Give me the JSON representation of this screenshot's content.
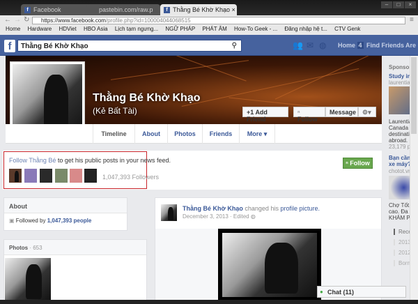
{
  "browser": {
    "tabs": [
      {
        "label": "Facebook"
      },
      {
        "label": "pastebin.com/raw.p"
      },
      {
        "label": "Thằng Bé Khờ Khạo"
      }
    ],
    "url_host": "https://www.facebook.com",
    "url_path": "/profile.php?id=100004044068515",
    "bookmarks": [
      "Home",
      "Hardware",
      "HDViet",
      "HBO Asia",
      "Lịch tạm ngưng...",
      "NGỮ PHÁP",
      "PHÁT ÂM",
      "How-To Geek - ...",
      "Đăng nhập hệ t...",
      "CTV Genk"
    ]
  },
  "fb": {
    "search_value": "Thằng Bé Khờ Khạo",
    "nav": {
      "home": "Home",
      "home_count": "4",
      "find_friends": "Find Friends",
      "more": "Are"
    }
  },
  "profile": {
    "name": "Thằng Bé Khờ Khạo",
    "alt_name": "(Kẻ Bất Tài)",
    "buttons": {
      "add_friend": "Add Friend",
      "follow": "Follow",
      "message": "Message"
    },
    "tabs": [
      "Timeline",
      "About",
      "Photos",
      "Friends",
      "More ▾"
    ]
  },
  "follow_box": {
    "link": "Follow Thằng Bé",
    "text": " to get his public posts in your news feed.",
    "followers": "1,047,393 Followers",
    "button": "Follow"
  },
  "about": {
    "title": "About",
    "followed_prefix": "Followed by ",
    "followed_count": "1,047,393 people"
  },
  "photos": {
    "title": "Photos",
    "count": " · 653"
  },
  "post": {
    "author": "Thằng Bé Khờ Khạo",
    "action": " changed his ",
    "link": "profile picture.",
    "date": "December 3, 2013 · Edited"
  },
  "sidebar": {
    "sponsored": "Sponsored",
    "ad1": {
      "title": "Study in C",
      "domain": "laurentian.c",
      "text": [
        "Laurentian",
        "Canada is a",
        "destination",
        "abroad. Fin",
        "23,179 peo"
      ]
    },
    "ad2": {
      "title": [
        "Bạn cần ti",
        "xe máy?"
      ],
      "domain": "chotot.vn",
      "text": [
        "Chợ Tốt.vn",
        "cao. Đa dạ",
        "KHÁM PHÁ"
      ]
    },
    "years": [
      "Recent",
      "2013",
      "2012",
      "Born"
    ]
  },
  "chat": {
    "label": "Chat (11)"
  },
  "colors": {
    "fb_blue": "#46629e",
    "follow_green": "#69a74e",
    "highlight_red": "#c8242a"
  }
}
